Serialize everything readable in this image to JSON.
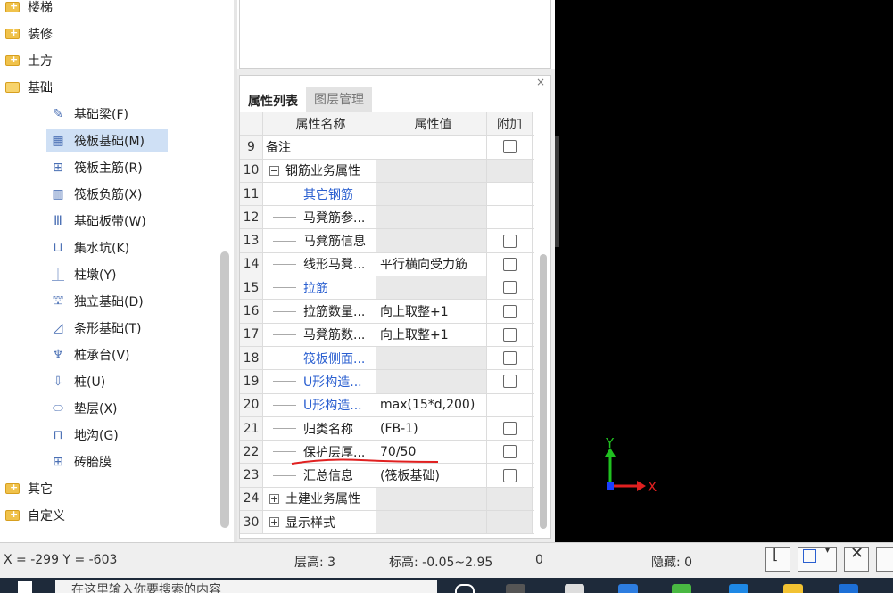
{
  "tree": {
    "top_items": [
      "楼梯",
      "装修",
      "土方",
      "基础"
    ],
    "sub_items": [
      {
        "label": "基础梁(F)",
        "icon": "pencil-icon"
      },
      {
        "label": "筏板基础(M)",
        "icon": "raft-icon"
      },
      {
        "label": "筏板主筋(R)",
        "icon": "grid-plus-icon"
      },
      {
        "label": "筏板负筋(X)",
        "icon": "rebar-icon"
      },
      {
        "label": "基础板带(W)",
        "icon": "strip-icon"
      },
      {
        "label": "集水坑(K)",
        "icon": "pit-icon"
      },
      {
        "label": "柱墩(Y)",
        "icon": "pier-icon"
      },
      {
        "label": "独立基础(D)",
        "icon": "footing-icon"
      },
      {
        "label": "条形基础(T)",
        "icon": "strip-footing-icon"
      },
      {
        "label": "桩承台(V)",
        "icon": "pile-cap-icon"
      },
      {
        "label": "桩(U)",
        "icon": "pile-icon"
      },
      {
        "label": "垫层(X)",
        "icon": "cushion-icon"
      },
      {
        "label": "地沟(G)",
        "icon": "trench-icon"
      },
      {
        "label": "砖胎膜",
        "icon": "brick-icon"
      }
    ],
    "bottom_items": [
      "其它",
      "自定义"
    ]
  },
  "props": {
    "tabs": [
      "属性列表",
      "图层管理"
    ],
    "headers": {
      "name": "属性名称",
      "value": "属性值",
      "extra": "附加"
    },
    "rows": [
      {
        "num": "9",
        "name": "备注",
        "value": "",
        "checkbox": true
      },
      {
        "num": "10",
        "name": "钢筋业务属性",
        "value": "",
        "checkbox": false,
        "expander": "−"
      },
      {
        "num": "11",
        "name": "其它钢筋",
        "value": "",
        "checkbox": false
      },
      {
        "num": "12",
        "name": "马凳筋参...",
        "value": "",
        "checkbox": false
      },
      {
        "num": "13",
        "name": "马凳筋信息",
        "value": "",
        "checkbox": true
      },
      {
        "num": "14",
        "name": "线形马凳...",
        "value": "平行横向受力筋",
        "checkbox": true
      },
      {
        "num": "15",
        "name": "拉筋",
        "value": "",
        "checkbox": true
      },
      {
        "num": "16",
        "name": "拉筋数量...",
        "value": "向上取整+1",
        "checkbox": true
      },
      {
        "num": "17",
        "name": "马凳筋数...",
        "value": "向上取整+1",
        "checkbox": true
      },
      {
        "num": "18",
        "name": "筏板侧面...",
        "value": "",
        "checkbox": true
      },
      {
        "num": "19",
        "name": "U形构造...",
        "value": "",
        "checkbox": true
      },
      {
        "num": "20",
        "name": "U形构造...",
        "value": "max(15*d,200)",
        "checkbox": false
      },
      {
        "num": "21",
        "name": "归类名称",
        "value": "(FB-1)",
        "checkbox": true
      },
      {
        "num": "22",
        "name": "保护层厚...",
        "value": "70/50",
        "checkbox": true
      },
      {
        "num": "23",
        "name": "汇总信息",
        "value": "(筏板基础)",
        "checkbox": true
      },
      {
        "num": "24",
        "name": "土建业务属性",
        "value": "",
        "checkbox": false,
        "expander": "+"
      },
      {
        "num": "30",
        "name": "显示样式",
        "value": "",
        "checkbox": false,
        "expander": "+"
      }
    ]
  },
  "axes": {
    "y": "Y",
    "x": "X"
  },
  "status": {
    "coords": "X = -299 Y = -603",
    "floor": "层高:  3",
    "elevation": "标高:  -0.05~2.95",
    "zero": "0",
    "hidden": "隐藏:  0"
  },
  "taskbar": {
    "search_placeholder": "在这里输入你要搜索的内容"
  },
  "colors": {
    "canvas": "#000000",
    "link_blue": "#2a5fd0",
    "axis_x": "#e02020",
    "axis_y": "#20c020"
  }
}
